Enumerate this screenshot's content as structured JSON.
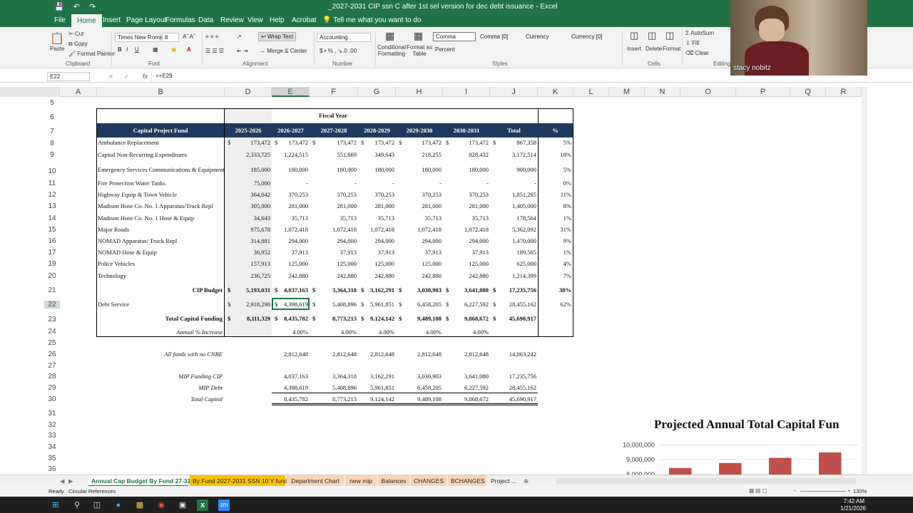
{
  "window": {
    "title": "_2027-2031 CIP ssn C after 1st sel version for dec debt issuance  -  Excel"
  },
  "menu": [
    "File",
    "Home",
    "Insert",
    "Page Layout",
    "Formulas",
    "Data",
    "Review",
    "View",
    "Help",
    "Acrobat",
    "Tell me what you want to do"
  ],
  "ribbon": {
    "cut": "Cut",
    "copy": "Copy",
    "format_painter": "Format Painter",
    "paste": "Paste",
    "font_name": "Times New Roma",
    "font_size": "8",
    "wrap_text": "Wrap Text",
    "merge_center": "Merge & Center",
    "number_format": "Accounting",
    "conditional_formatting": "Conditional Formatting",
    "format_as_table": "Format as Table",
    "styles": [
      "Comma",
      "Comma [0]",
      "Currency",
      "Currency [0]",
      "Percent"
    ],
    "insert": "Insert",
    "delete": "Delete",
    "format": "Format",
    "autosum": "AutoSum",
    "fill": "Fill",
    "clear": "Clear",
    "groups": [
      "Clipboard",
      "Font",
      "Alignment",
      "Number",
      "Styles",
      "Cells",
      "Editing"
    ]
  },
  "formula_bar": {
    "name_box": "E22",
    "fx": "fx",
    "formula": "=+E29"
  },
  "columns": [
    "A",
    "B",
    "D",
    "E",
    "F",
    "G",
    "H",
    "I",
    "J",
    "K",
    "L",
    "M",
    "N",
    "O",
    "P",
    "Q",
    "R"
  ],
  "rows": [
    "5",
    "6",
    "7",
    "8",
    "9",
    "10",
    "11",
    "12",
    "13",
    "14",
    "15",
    "16",
    "17",
    "19",
    "20",
    "21",
    "22",
    "23",
    "24",
    "25",
    "26",
    "27",
    "28",
    "29",
    "30",
    "31",
    "32",
    "33",
    "34",
    "35",
    "36"
  ],
  "table": {
    "fiscal_year": "Fiscal Year",
    "headers": [
      "Capital Project Fund",
      "2025-2026",
      "2026-2027",
      "2027-2028",
      "2028-2029",
      "2029-2030",
      "2030-2031",
      "Total",
      "%"
    ],
    "rows": [
      {
        "name": "Ambulance Replacement",
        "vals": [
          "173,472",
          "173,472",
          "173,472",
          "173,472",
          "173,472",
          "173,472",
          "867,358"
        ],
        "pct": "5%",
        "dollar": true
      },
      {
        "name": "Capital Non-Recurring Expenditures",
        "vals": [
          "2,333,725",
          "1,224,515",
          "551,669",
          "349,643",
          "218,255",
          "828,432",
          "3,172,514"
        ],
        "pct": "18%"
      },
      {
        "name": "Emergency Services Communications & Equipment",
        "vals": [
          "185,000",
          "180,000",
          "180,000",
          "180,000",
          "180,000",
          "180,000",
          "900,000"
        ],
        "pct": "5%"
      },
      {
        "name": "Fire Protection Water Tanks",
        "vals": [
          "75,000",
          "-",
          "-",
          "-",
          "-",
          "-",
          "-"
        ],
        "pct": "0%"
      },
      {
        "name": "Highway Equip & Town Vehicle",
        "vals": [
          "364,042",
          "370,253",
          "370,253",
          "370,253",
          "370,253",
          "370,253",
          "1,851,265"
        ],
        "pct": "11%"
      },
      {
        "name": "Madison Hose Co. No. 1 Apparatus/Truck Repl",
        "vals": [
          "305,000",
          "281,000",
          "281,000",
          "281,000",
          "281,000",
          "281,000",
          "1,405,000"
        ],
        "pct": "8%"
      },
      {
        "name": "Madison Hose Co. No. 1 Hose & Equip",
        "vals": [
          "34,643",
          "35,713",
          "35,713",
          "35,713",
          "35,713",
          "35,713",
          "178,564"
        ],
        "pct": "1%"
      },
      {
        "name": "Major Roads",
        "vals": [
          "975,678",
          "1,072,418",
          "1,072,418",
          "1,072,418",
          "1,072,418",
          "1,072,418",
          "5,362,092"
        ],
        "pct": "31%"
      },
      {
        "name": "NOMAD Apparatus/ Truck Repl",
        "vals": [
          "314,881",
          "294,000",
          "294,000",
          "294,000",
          "294,000",
          "294,000",
          "1,470,000"
        ],
        "pct": "9%"
      },
      {
        "name": "NOMAD Hose & Equip",
        "vals": [
          "36,952",
          "37,913",
          "37,913",
          "37,913",
          "37,913",
          "37,913",
          "189,565"
        ],
        "pct": "1%"
      },
      {
        "name": "Police Vehicles",
        "vals": [
          "157,913",
          "125,000",
          "125,000",
          "125,000",
          "125,000",
          "125,000",
          "625,000"
        ],
        "pct": "4%"
      },
      {
        "name": "Technology",
        "vals": [
          "236,725",
          "242,880",
          "242,880",
          "242,880",
          "242,880",
          "242,880",
          "1,214,399"
        ],
        "pct": "7%"
      }
    ],
    "cip_budget": {
      "label": "CIP Budget",
      "vals": [
        "5,193,031",
        "4,037,163",
        "3,364,318",
        "3,162,291",
        "3,030,903",
        "3,641,080",
        "17,235,756"
      ],
      "pct": "38%"
    },
    "debt_service": {
      "label": "Debt Service",
      "vals": [
        "2,918,298",
        "4,398,619",
        "5,408,896",
        "5,961,851",
        "6,458,205",
        "6,227,592",
        "28,455,162"
      ],
      "pct": "62%"
    },
    "total_funding": {
      "label": "Total Capital Funding",
      "vals": [
        "8,111,329",
        "8,435,782",
        "8,773,213",
        "9,124,142",
        "9,489,108",
        "9,868,672",
        "45,690,917"
      ]
    },
    "annual_increase": {
      "label": "Annual % Increase",
      "vals": [
        "",
        "4.00%",
        "4.00%",
        "4.00%",
        "4.00%",
        "4.00%"
      ]
    },
    "all_funds": {
      "label": "All funds with no CNRE",
      "vals": [
        "2,812,648",
        "2,812,648",
        "2,812,648",
        "2,812,648",
        "2,812,648",
        "14,063,242"
      ]
    },
    "mip_cip": {
      "label": "MIP Funding CIP",
      "vals": [
        "4,037,163",
        "3,364,318",
        "3,162,291",
        "3,030,903",
        "3,641,080",
        "17,235,756"
      ]
    },
    "mip_debt": {
      "label": "MIP Debt",
      "vals": [
        "4,398,619",
        "5,408,896",
        "5,961,851",
        "6,458,205",
        "6,227,592",
        "28,455,162"
      ]
    },
    "total_capital": {
      "label": "Total Capital",
      "vals": [
        "8,435,782",
        "8,773,213",
        "9,124,142",
        "9,489,108",
        "9,868,672",
        "45,690,917"
      ]
    },
    "dollar_sign": "$"
  },
  "chart_data": {
    "type": "bar",
    "title": "Projected Annual Total Capital Fun",
    "yticks": [
      "10,000,000",
      "9,000,000",
      "8,000,000"
    ],
    "ylim": [
      7900000,
      10500000
    ],
    "categories": [
      "",
      "",
      "",
      ""
    ],
    "values": [
      8435782,
      8773213,
      9124142,
      9489108
    ],
    "bar_color": "#c0504d"
  },
  "sheet_tabs": [
    "Annual Cap Budget By Fund 27-31",
    "By Fund 2027-2031 SSN 10 Y fund",
    "Department Chart",
    "new mip",
    "Balances",
    "CHANGES",
    "BCHANGES",
    "Project ..."
  ],
  "status": {
    "ready": "Ready",
    "circular": "Circular References",
    "zoom": "130%"
  },
  "webcam": {
    "name": "stacy nobitz"
  },
  "clock": {
    "time": "7:42 AM",
    "date": "1/21/2026"
  },
  "colors": {
    "excel_green": "#217346",
    "header_navy": "#1f3a5f"
  }
}
